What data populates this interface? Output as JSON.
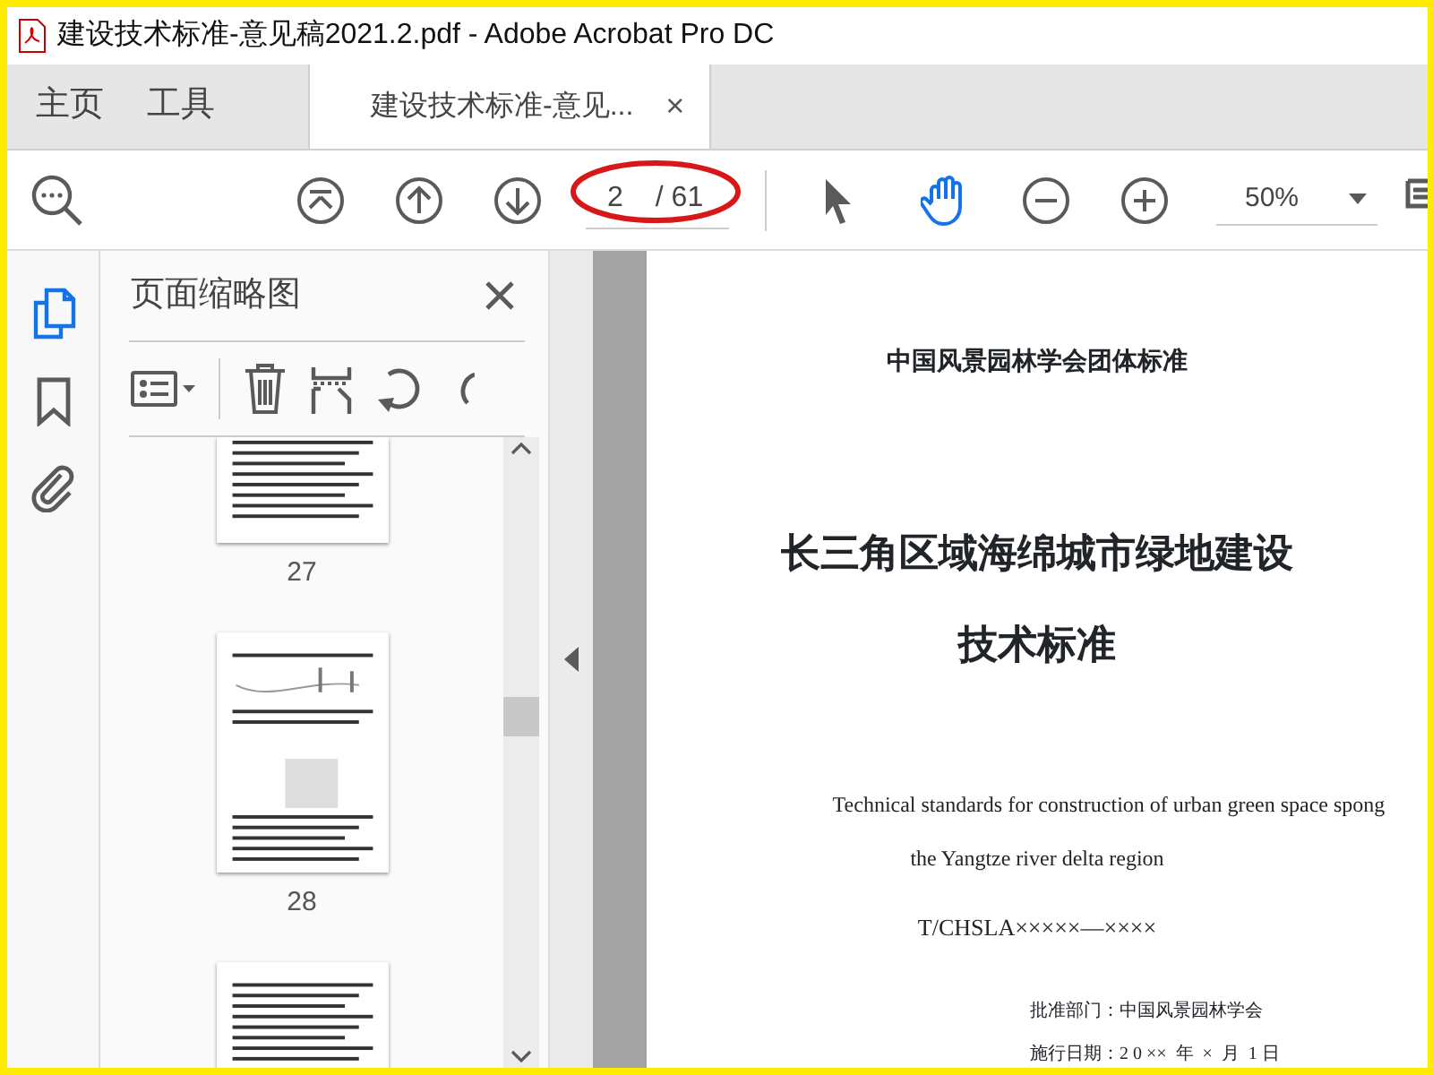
{
  "window": {
    "title": "建设技术标准-意见稿2021.2.pdf - Adobe Acrobat Pro DC"
  },
  "tabs": [
    {
      "label": "主页",
      "selected": false
    },
    {
      "label": "工具",
      "selected": false
    },
    {
      "label": "建设技术标准-意见...",
      "selected": true,
      "close": "×"
    }
  ],
  "toolbar": {
    "page_current": "2",
    "page_total": "/ 61",
    "zoom": "50%",
    "tools": [
      {
        "kind": "select",
        "selected": false
      },
      {
        "kind": "hand",
        "selected": true
      }
    ]
  },
  "side_rail": [
    {
      "kind": "pages",
      "selected": true
    },
    {
      "kind": "bookmark",
      "selected": false
    },
    {
      "kind": "attachment",
      "selected": false
    }
  ],
  "panel": {
    "title": "页面缩略图",
    "thumbnails": [
      {
        "kind": "text",
        "label": "27"
      },
      {
        "kind": "figure",
        "label": "28"
      },
      {
        "kind": "partial"
      }
    ]
  },
  "document": {
    "lines": [
      {
        "kind": "org",
        "text": "中国风景园林学会团体标准"
      },
      {
        "kind": "title",
        "text": "长三角区域海绵城市绿地建设"
      },
      {
        "kind": "title",
        "text": "技术标准"
      },
      {
        "kind": "english",
        "text": "Technical standards for construction of urban green space spong"
      },
      {
        "kind": "english2",
        "text": "the Yangtze river delta region"
      },
      {
        "kind": "code",
        "text": "T/CHSLA×××××—××××"
      },
      {
        "kind": "meta",
        "text": "批准部门：中国风景园林学会"
      },
      {
        "kind": "meta",
        "text": "施行日期：2 0 ××  年  ×  月  1 日"
      }
    ]
  }
}
